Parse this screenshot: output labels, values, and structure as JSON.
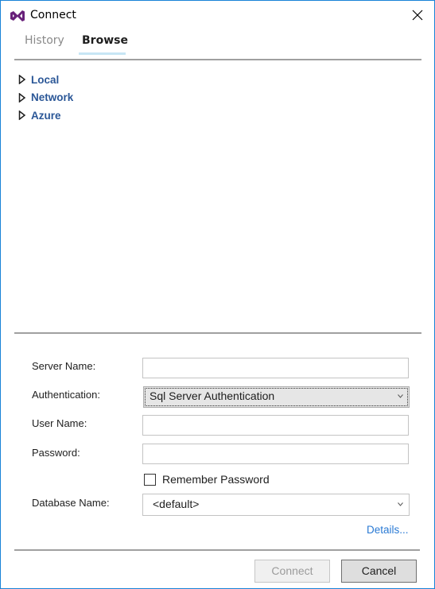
{
  "window": {
    "title": "Connect",
    "icon": "visual-studio-logo-icon",
    "accent_color": "#68217a",
    "border_color": "#1883d7"
  },
  "tabs": [
    {
      "label": "History",
      "active": false
    },
    {
      "label": "Browse",
      "active": true
    }
  ],
  "tree": {
    "items": [
      {
        "label": "Local",
        "expanded": false
      },
      {
        "label": "Network",
        "expanded": false
      },
      {
        "label": "Azure",
        "expanded": false
      }
    ]
  },
  "form": {
    "server_name": {
      "label": "Server Name:",
      "value": ""
    },
    "authentication": {
      "label": "Authentication:",
      "value": "Sql Server Authentication"
    },
    "user_name": {
      "label": "User Name:",
      "value": ""
    },
    "password": {
      "label": "Password:",
      "value": ""
    },
    "remember_password": {
      "label": "Remember Password",
      "checked": false
    },
    "database_name": {
      "label": "Database Name:",
      "value": "<default>"
    },
    "details_link": "Details..."
  },
  "buttons": {
    "connect": {
      "label": "Connect",
      "enabled": false
    },
    "cancel": {
      "label": "Cancel",
      "enabled": true
    }
  }
}
